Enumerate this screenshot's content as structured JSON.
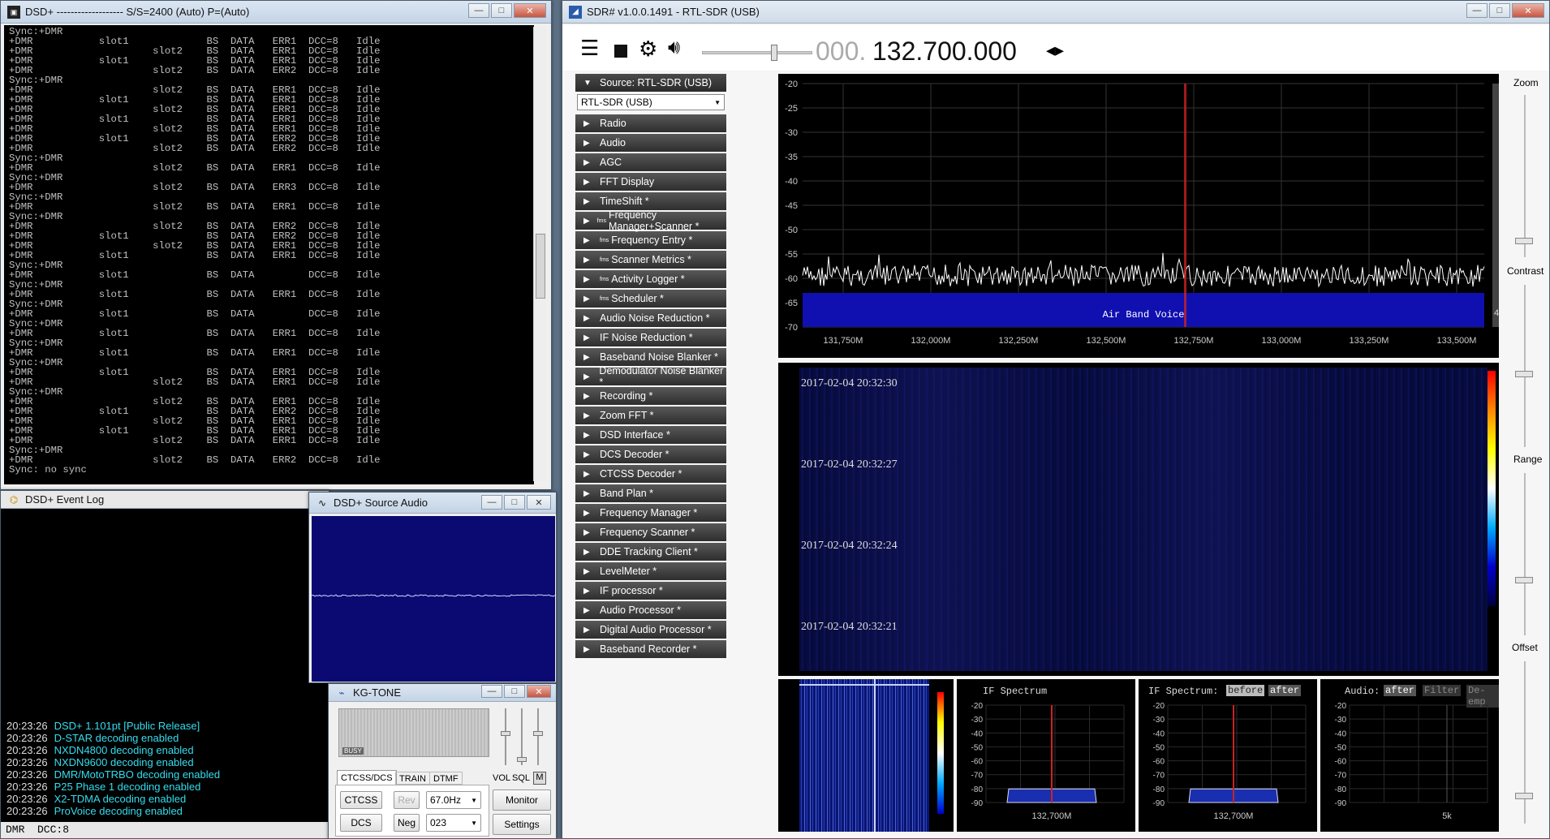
{
  "dsd_console": {
    "title": "DSD+    -------------------  S/S=2400 (Auto) P=(Auto)",
    "lines": [
      "Sync:+DMR",
      "+DMR           slot1             BS  DATA   ERR1  DCC=8   Idle",
      "+DMR                    slot2    BS  DATA   ERR1  DCC=8   Idle",
      "+DMR           slot1             BS  DATA   ERR1  DCC=8   Idle",
      "+DMR                    slot2    BS  DATA   ERR2  DCC=8   Idle",
      "Sync:+DMR",
      "+DMR                    slot2    BS  DATA   ERR1  DCC=8   Idle",
      "+DMR           slot1             BS  DATA   ERR1  DCC=8   Idle",
      "+DMR                    slot2    BS  DATA   ERR1  DCC=8   Idle",
      "+DMR           slot1             BS  DATA   ERR1  DCC=8   Idle",
      "+DMR                    slot2    BS  DATA   ERR1  DCC=8   Idle",
      "+DMR           slot1             BS  DATA   ERR2  DCC=8   Idle",
      "+DMR                    slot2    BS  DATA   ERR2  DCC=8   Idle",
      "Sync:+DMR",
      "+DMR                    slot2    BS  DATA   ERR1  DCC=8   Idle",
      "Sync:+DMR",
      "+DMR                    slot2    BS  DATA   ERR3  DCC=8   Idle",
      "Sync:+DMR",
      "+DMR                    slot2    BS  DATA   ERR1  DCC=8   Idle",
      "Sync:+DMR",
      "+DMR                    slot2    BS  DATA   ERR2  DCC=8   Idle",
      "+DMR           slot1             BS  DATA   ERR2  DCC=8   Idle",
      "+DMR                    slot2    BS  DATA   ERR1  DCC=8   Idle",
      "+DMR           slot1             BS  DATA   ERR1  DCC=8   Idle",
      "Sync:+DMR",
      "+DMR           slot1             BS  DATA         DCC=8   Idle",
      "Sync:+DMR",
      "+DMR           slot1             BS  DATA   ERR1  DCC=8   Idle",
      "Sync:+DMR",
      "+DMR           slot1             BS  DATA         DCC=8   Idle",
      "Sync:+DMR",
      "+DMR           slot1             BS  DATA   ERR1  DCC=8   Idle",
      "Sync:+DMR",
      "+DMR           slot1             BS  DATA   ERR1  DCC=8   Idle",
      "Sync:+DMR",
      "+DMR           slot1             BS  DATA   ERR1  DCC=8   Idle",
      "+DMR                    slot2    BS  DATA   ERR1  DCC=8   Idle",
      "Sync:+DMR",
      "+DMR                    slot2    BS  DATA   ERR1  DCC=8   Idle",
      "+DMR           slot1             BS  DATA   ERR2  DCC=8   Idle",
      "+DMR                    slot2    BS  DATA   ERR1  DCC=8   Idle",
      "+DMR           slot1             BS  DATA   ERR1  DCC=8   Idle",
      "+DMR                    slot2    BS  DATA   ERR1  DCC=8   Idle",
      "Sync:+DMR",
      "+DMR                    slot2    BS  DATA   ERR2  DCC=8   Idle",
      "Sync: no sync"
    ]
  },
  "event_log": {
    "title": "DSD+ Event Log",
    "entries": [
      {
        "time": "20:23:26",
        "text": "DSD+ 1.101pt  [Public Release]"
      },
      {
        "time": "20:23:26",
        "text": "D-STAR decoding enabled"
      },
      {
        "time": "20:23:26",
        "text": "NXDN4800 decoding enabled"
      },
      {
        "time": "20:23:26",
        "text": "NXDN9600 decoding enabled"
      },
      {
        "time": "20:23:26",
        "text": "DMR/MotoTRBO decoding enabled"
      },
      {
        "time": "20:23:26",
        "text": "P25 Phase 1 decoding enabled"
      },
      {
        "time": "20:23:26",
        "text": "X2-TDMA decoding enabled"
      },
      {
        "time": "20:23:26",
        "text": "ProVoice decoding enabled"
      }
    ],
    "status": "DMR  DCC:8"
  },
  "source_audio": {
    "title": "DSD+ Source Audio"
  },
  "kgtone": {
    "title": "KG-TONE",
    "busy_label": "BUSY",
    "tabs": [
      "CTCSS/DCS",
      "TRAIN",
      "DTMF"
    ],
    "ctcss_label": "CTCSS",
    "dcs_label": "DCS",
    "rev_label": "Rev",
    "neg_label": "Neg",
    "tone_value": "67.0Hz",
    "dcs_value": "023",
    "vol_label": "VOL",
    "sql_label": "SQL",
    "mute_label": "M",
    "monitor_label": "Monitor",
    "settings_label": "Settings"
  },
  "sdr": {
    "title": "SDR# v1.0.0.1491 - RTL-SDR (USB)",
    "frequency_dim": "000.",
    "frequency": "132.700.000",
    "source_header": "Source: RTL-SDR (USB)",
    "source_select": "RTL-SDR (USB)",
    "panels": [
      "Radio",
      "Audio",
      "AGC",
      "FFT Display",
      "TimeShift *",
      "Frequency Manager+Scanner *",
      "Frequency Entry *",
      "Scanner Metrics *",
      "Activity Logger *",
      "Scheduler *",
      "Audio Noise Reduction *",
      "IF Noise Reduction *",
      "Baseband Noise Blanker *",
      "Demodulator Noise Blanker *",
      "Recording *",
      "Zoom FFT *",
      "DSD Interface *",
      "DCS Decoder *",
      "CTCSS Decoder *",
      "Band Plan *",
      "Frequency Manager *",
      "Frequency Scanner *",
      "DDE Tracking Client *",
      "LevelMeter *",
      "IF processor *",
      "Audio Processor *",
      "Digital Audio Processor *",
      "Baseband Recorder *"
    ],
    "fms_panels": [
      5,
      6,
      7,
      8,
      9
    ],
    "fms_label": "fms",
    "spectrum": {
      "y_ticks": [
        "-20",
        "-25",
        "-30",
        "-35",
        "-40",
        "-45",
        "-50",
        "-55",
        "-60",
        "-65",
        "-70"
      ],
      "x_ticks": [
        "131,750M",
        "132,000M",
        "132,250M",
        "132,500M",
        "132,750M",
        "133,000M",
        "133,250M",
        "133,500M"
      ],
      "band_label": "Air Band Voice",
      "side_value": "4"
    },
    "waterfall_times": [
      "2017-02-04 20:32:30",
      "2017-02-04 20:32:27",
      "2017-02-04 20:32:24",
      "2017-02-04 20:32:21"
    ],
    "sliders": {
      "zoom": "Zoom",
      "contrast": "Contrast",
      "range": "Range",
      "offset": "Offset"
    },
    "if_spectrum": {
      "title": "IF Spectrum",
      "y_ticks": [
        "-20",
        "-30",
        "-40",
        "-50",
        "-60",
        "-70",
        "-80",
        "-90"
      ],
      "x_label": "132,700M"
    },
    "if_spectrum2": {
      "title": "IF Spectrum:",
      "before": "before",
      "after": "after",
      "x_label": "132,700M"
    },
    "audio_spectrum": {
      "title": "Audio:",
      "after": "after",
      "filter": "Filter",
      "deemp": "De-emp",
      "x_label": "5k"
    }
  },
  "colors": {
    "accent_red": "#cc2222",
    "spectrum_blue": "#1010b0",
    "log_cyan": "#33ddee"
  }
}
